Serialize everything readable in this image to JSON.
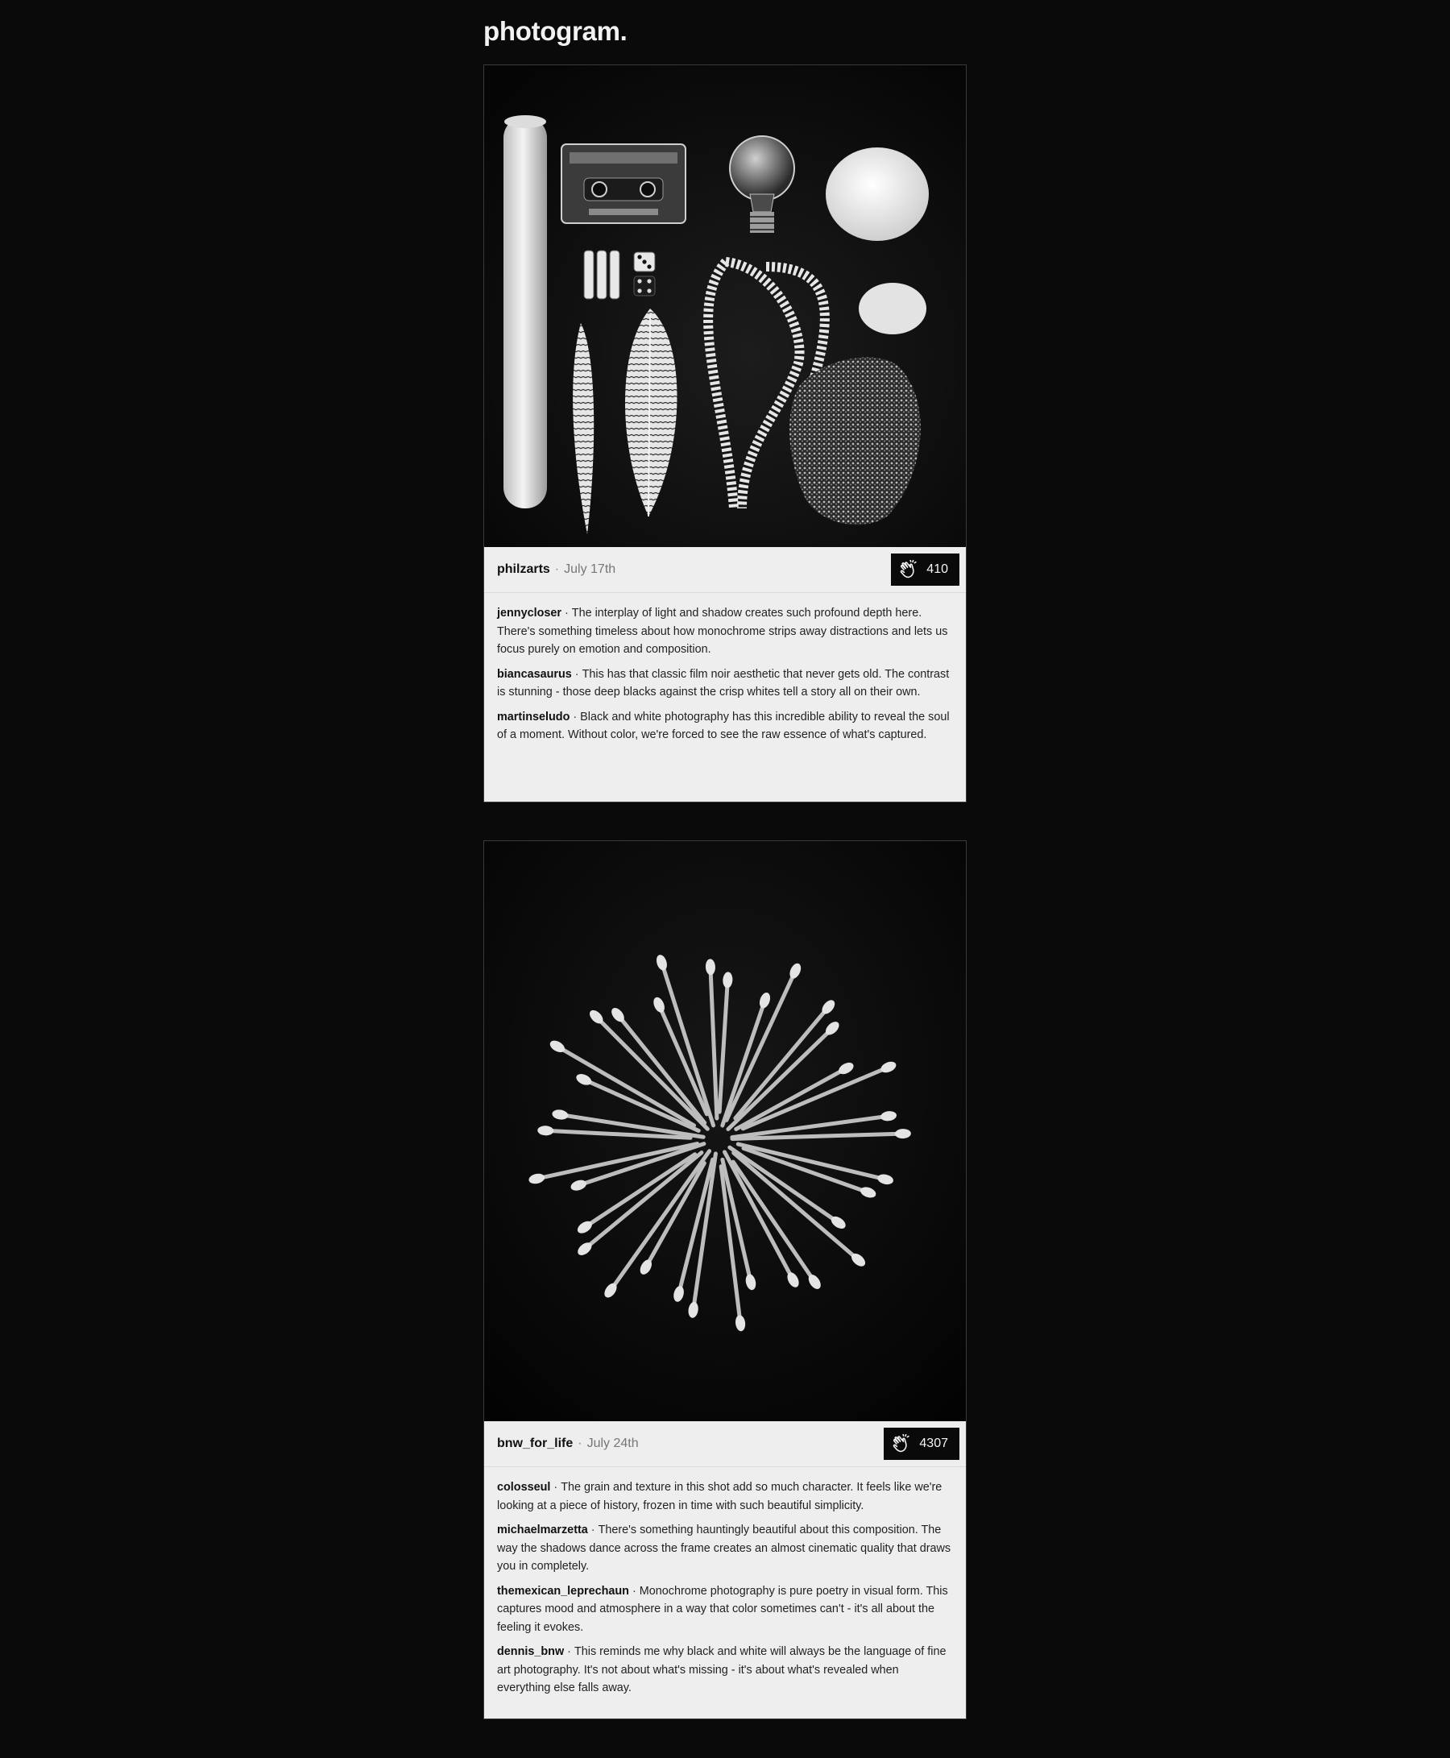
{
  "app": {
    "brand": "photogram."
  },
  "posts": [
    {
      "author": "philzarts",
      "separator": "·",
      "date": "July 17th",
      "claps": "410",
      "clap_icon": "clapping-hands-icon",
      "photo": "flat-lay-objects",
      "comments": [
        {
          "user": "jennycloser",
          "text": "The interplay of light and shadow creates such profound depth here. There's something timeless about how monochrome strips away distractions and lets us focus purely on emotion and composition."
        },
        {
          "user": "biancasaurus",
          "text": "This has that classic film noir aesthetic that never gets old. The contrast is stunning - those deep blacks against the crisp whites tell a story all on their own."
        },
        {
          "user": "martinseludo",
          "text": "Black and white photography has this incredible ability to reveal the soul of a moment. Without color, we're forced to see the raw essence of what's captured."
        }
      ]
    },
    {
      "author": "bnw_for_life",
      "separator": "·",
      "date": "July 24th",
      "claps": "4307",
      "clap_icon": "clapping-hands-icon",
      "photo": "cotton-swab-starburst",
      "comments": [
        {
          "user": "colosseul",
          "text": "The grain and texture in this shot add so much character. It feels like we're looking at a piece of history, frozen in time with such beautiful simplicity."
        },
        {
          "user": "michaelmarzetta",
          "text": "There's something hauntingly beautiful about this composition. The way the shadows dance across the frame creates an almost cinematic quality that draws you in completely."
        },
        {
          "user": "themexican_leprechaun",
          "text": "Monochrome photography is pure poetry in visual form. This captures mood and atmosphere in a way that color sometimes can't - it's all about the feeling it evokes."
        },
        {
          "user": "dennis_bnw",
          "text": "This reminds me why black and white will always be the language of fine art photography. It's not about what's missing - it's about what's revealed when everything else falls away."
        }
      ]
    }
  ]
}
